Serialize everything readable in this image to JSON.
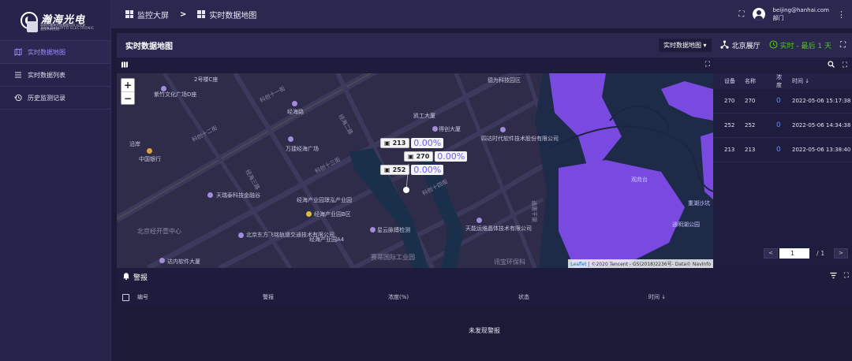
{
  "brand": {
    "name": "瀚海光电",
    "english": "HAN HAI OPTO ELECTRONIC",
    "sub": "深圳市瀚海光电有限公司 公共安全技术研究院"
  },
  "sidebar": {
    "items": [
      {
        "label": "实时数据地图",
        "icon": "map-icon",
        "active": true
      },
      {
        "label": "实时数据列表",
        "icon": "list-icon",
        "active": false
      },
      {
        "label": "历史监测记录",
        "icon": "history-icon",
        "active": false
      }
    ]
  },
  "topbar": {
    "crumb1": "监控大屏",
    "crumb2": "实时数据地图",
    "separator": ">",
    "user_email": "beijing@hanhai.com",
    "user_dept": "部门"
  },
  "panel": {
    "title": "实时数据地图",
    "view_select": "实时数据地图",
    "venue": "北京展厅",
    "live": "实时 - 最后 1 天"
  },
  "map": {
    "zoom_in": "+",
    "zoom_out": "−",
    "attribution_link": "Leaflet",
    "attribution_text": " | ©2020 Tencent - GS(2018)2236号- Data© NavInfo",
    "markers": [
      {
        "id": "213",
        "pct": "0.00%"
      },
      {
        "id": "270",
        "pct": "0.00%"
      },
      {
        "id": "252",
        "pct": "0.00%"
      }
    ],
    "labels": {
      "l1": "紫竹文化广场D座",
      "l2": "经海路",
      "l3": "中国银行",
      "l4": "万捷经海广场",
      "l5": "天瑞泰科技金融谷",
      "l6": "经海产业园璟泓产业园",
      "l7": "经海产业园B区",
      "l8": "北京东方飞铭轨道交通技术有限公司",
      "l9": "经海产业园A4",
      "l10": "星云脉搏检测",
      "l11": "天能运维晶体技术有限公司",
      "l12": "四达时代软件技术股份有限公司",
      "l13": "凯工大厦",
      "l14": "得创大厦",
      "l15": "德为科技园区",
      "l16": "观苑台",
      "l17": "重湖沙坑",
      "l18": "通明湖公园",
      "l19": "达内软件大厦",
      "l20": "北京经开壹中心",
      "l21": "沿岸",
      "l22": "2号楼C座",
      "l23": "科创十二街",
      "l24": "科创十三街",
      "l25": "科创十四街",
      "l26": "赛蒂国际工业园",
      "l27": "讯宝环保科",
      "l28": "科创十一街",
      "l29": "经海三路",
      "l30": "经海二路",
      "l31": "通惠干渠"
    }
  },
  "data_list": {
    "headers": [
      "设备",
      "名称",
      "浓度",
      "时间 ↓"
    ],
    "rows": [
      {
        "device": "270",
        "name": "270",
        "conc": "0",
        "time": "2022-05-06 15:17:38"
      },
      {
        "device": "252",
        "name": "252",
        "conc": "0",
        "time": "2022-05-06 14:34:38"
      },
      {
        "device": "213",
        "name": "213",
        "conc": "0",
        "time": "2022-05-06 13:38:40"
      }
    ],
    "page": "1",
    "total": "/  1"
  },
  "alarm": {
    "title": "警报",
    "headers": [
      "编号",
      "警报",
      "浓度(%)",
      "状态",
      "时间 ↓"
    ],
    "empty": "未发现警报"
  }
}
